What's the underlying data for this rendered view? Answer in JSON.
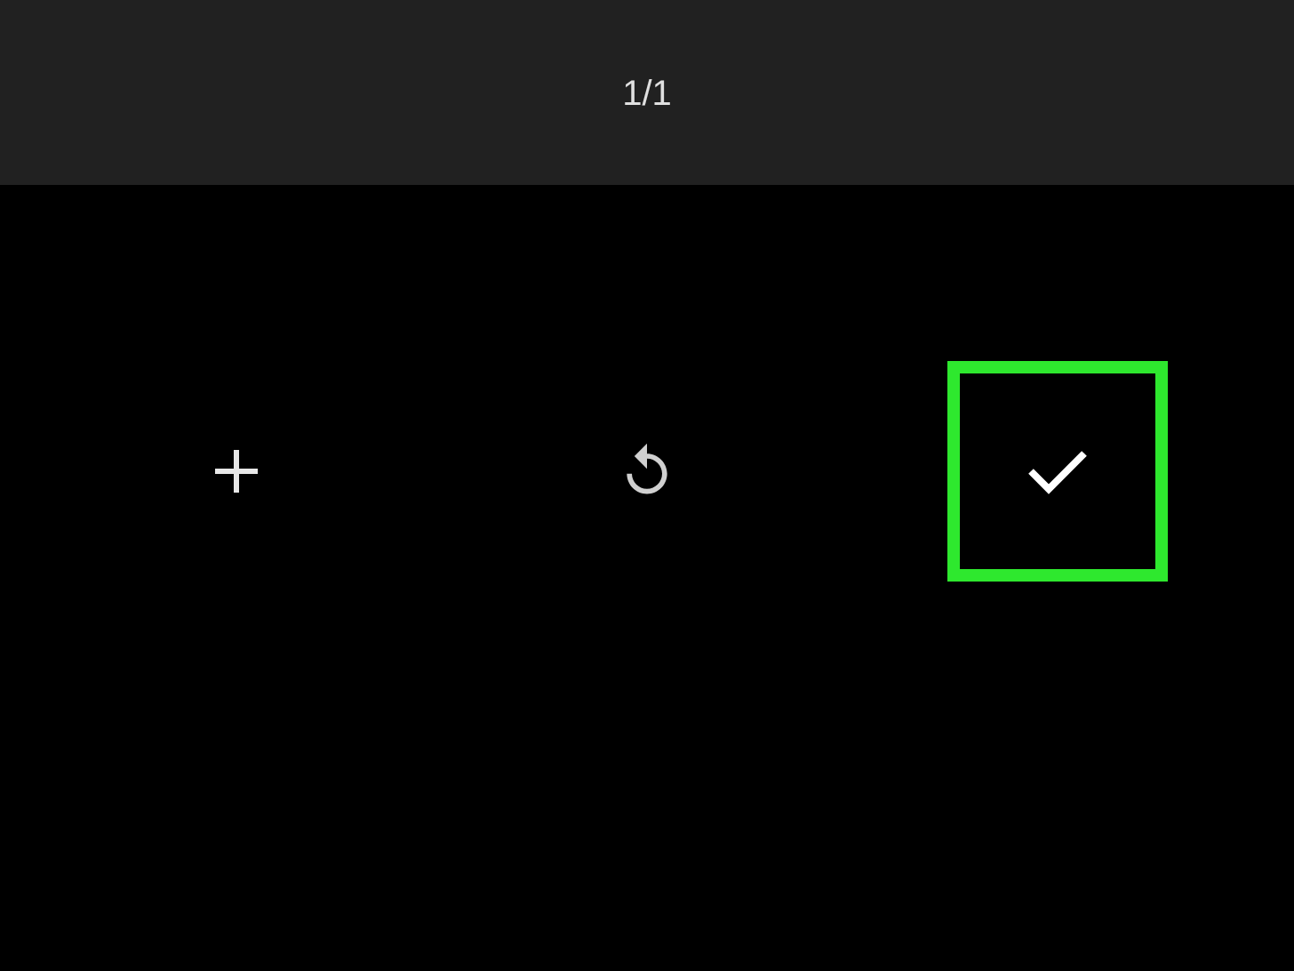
{
  "header": {
    "page_indicator": "1/1"
  },
  "buttons": [
    {
      "kind": "add",
      "highlighted": false
    },
    {
      "kind": "rotate",
      "highlighted": false
    },
    {
      "kind": "confirm",
      "highlighted": true
    }
  ]
}
